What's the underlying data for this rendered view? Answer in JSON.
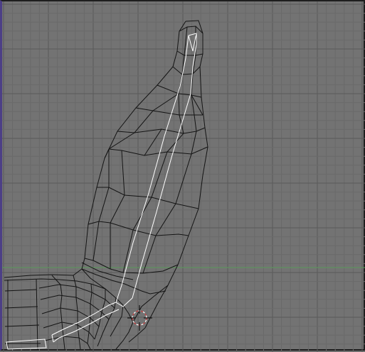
{
  "viewport": {
    "name": "3d-viewport-wireframe",
    "background": "#737373",
    "grid_minor_color": "#6a6a6a",
    "grid_major_color": "#595959",
    "x_axis_color": "#5a9a5a",
    "wire_color": "#141414",
    "selected_wire_color": "#ffffff",
    "cursor_ring_color": "#c83a3a",
    "cursor_cross_color": "#000000",
    "object": "finger-mesh-wireframe",
    "cursor_icon": "3d-cursor-icon"
  }
}
